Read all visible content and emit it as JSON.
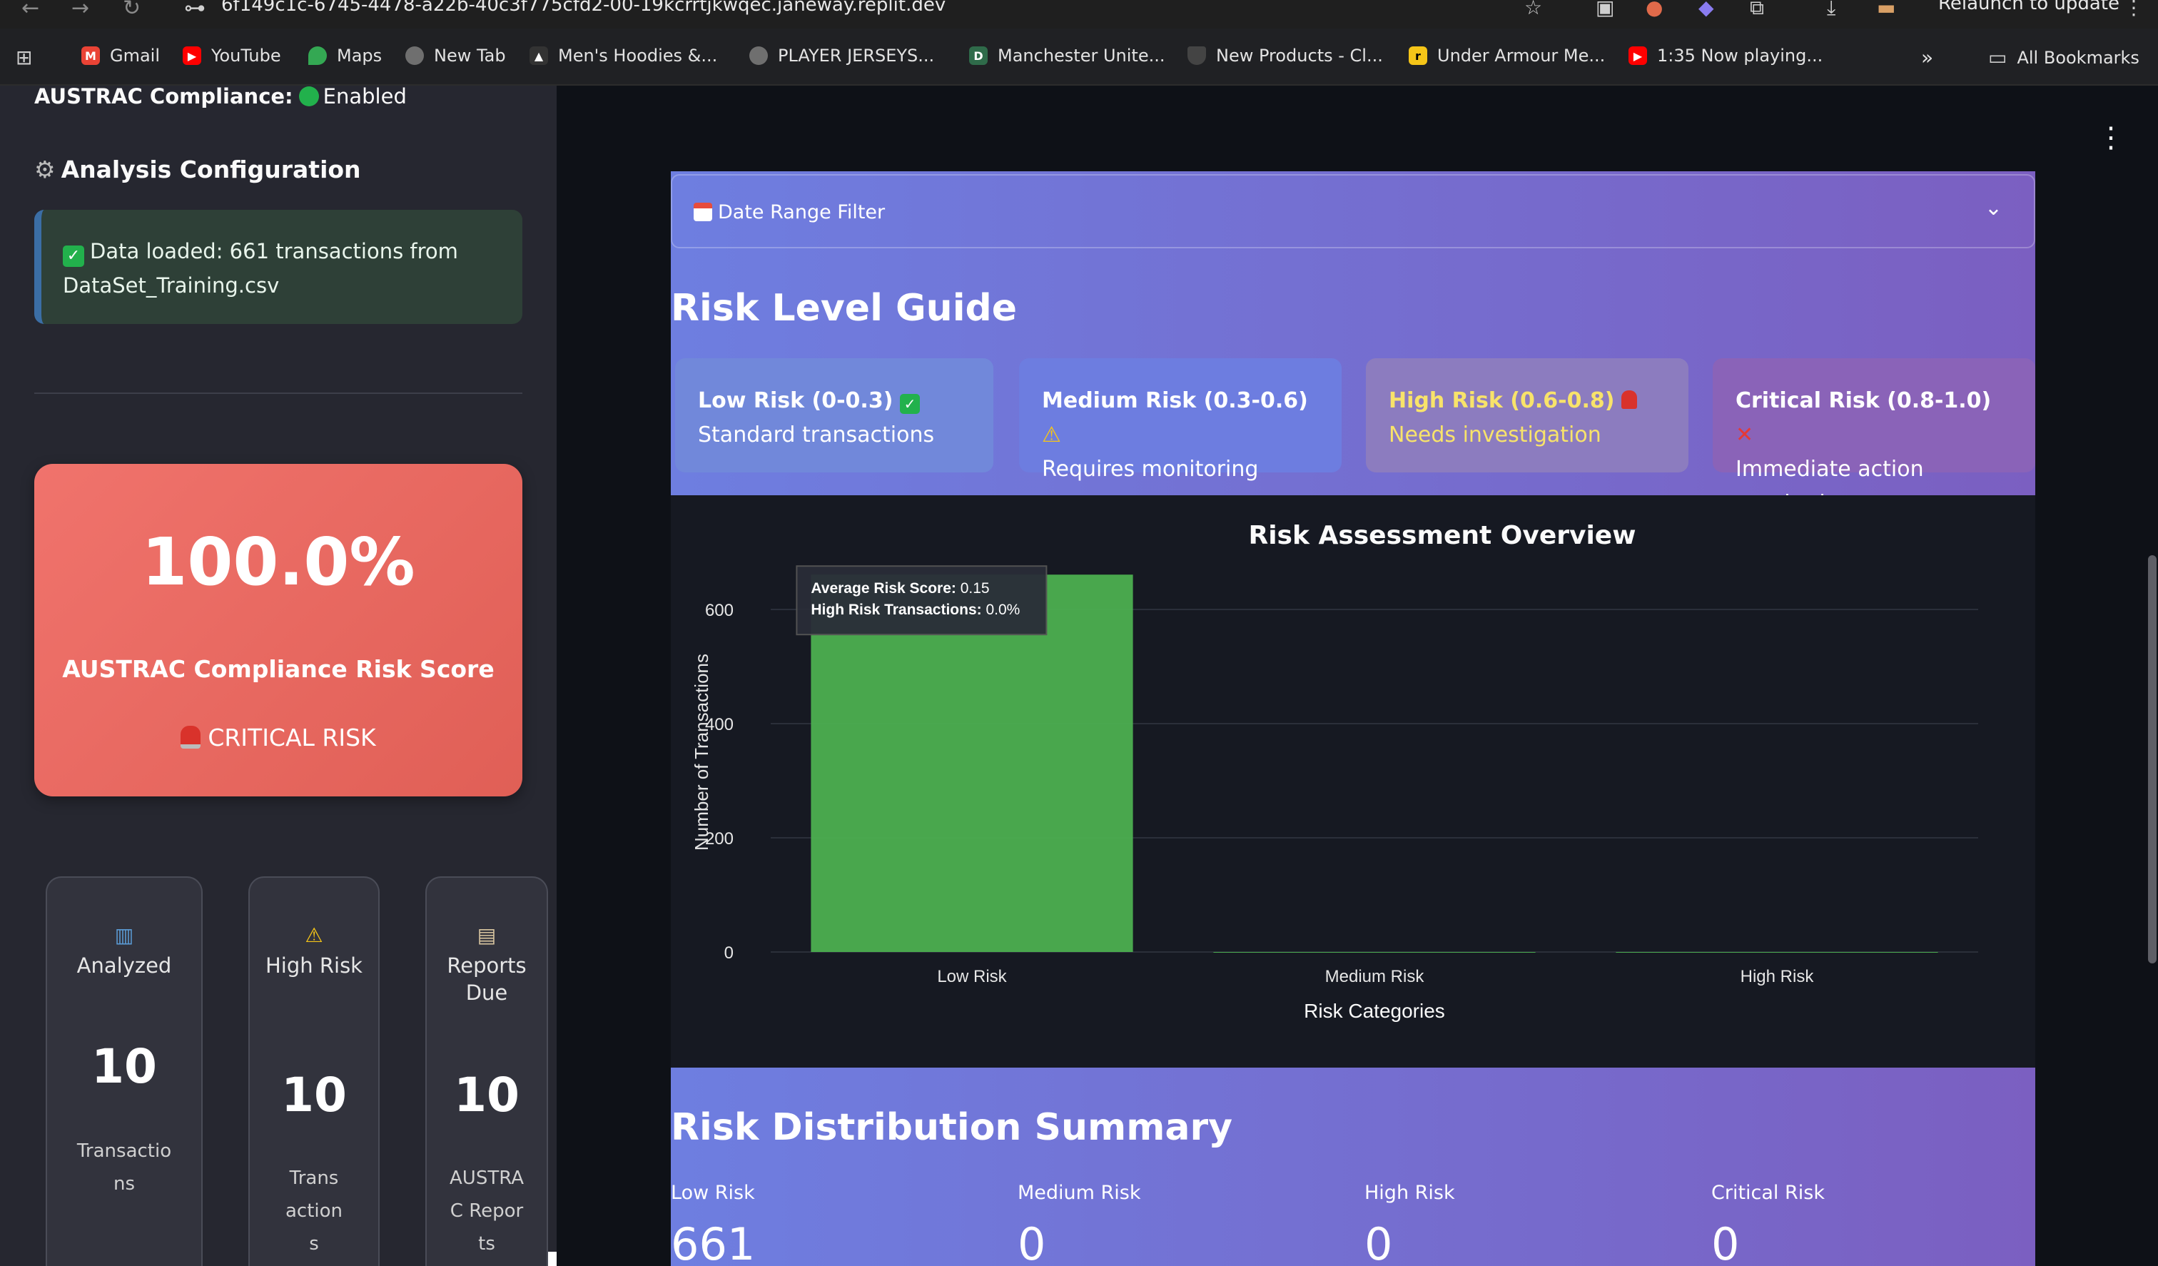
{
  "browser": {
    "url": "6f149c1c-6745-4478-a22b-40c3f775cfd2-00-19kcrrtjkwqec.janeway.replit.dev",
    "relaunch_label": "Relaunch to update",
    "bookmarks": [
      {
        "label": "Gmail",
        "icon": "gmail-icon",
        "color": "#ea4335"
      },
      {
        "label": "YouTube",
        "icon": "youtube-icon",
        "color": "#ff0000"
      },
      {
        "label": "Maps",
        "icon": "maps-pin-icon",
        "color": "#34a853"
      },
      {
        "label": "New Tab",
        "icon": "globe-icon",
        "color": "#8a8a8a"
      },
      {
        "label": "Men's Hoodies &...",
        "icon": "brand-icon",
        "color": "#444444"
      },
      {
        "label": "PLAYER JERSEYS...",
        "icon": "globe-icon",
        "color": "#8a8a8a"
      },
      {
        "label": "Manchester Unite...",
        "icon": "d-icon",
        "color": "#2f6b4a"
      },
      {
        "label": "New Products - Cl...",
        "icon": "shield-icon",
        "color": "#555555"
      },
      {
        "label": "Under Armour Me...",
        "icon": "r-icon",
        "color": "#f5c518"
      },
      {
        "label": "1:35 Now playing...",
        "icon": "youtube-icon",
        "color": "#ff0000"
      }
    ],
    "more_label": "»",
    "all_bookmarks": "All Bookmarks"
  },
  "sidebar": {
    "compliance_label": "AUSTRAC Compliance:",
    "compliance_value": "Enabled",
    "section_heading": "Analysis Configuration",
    "success_message": "Data loaded: 661 transactions from DataSet_Training.csv",
    "risk_score": {
      "value": "100.0%",
      "label": "AUSTRAC Compliance Risk Score",
      "status": "CRITICAL RISK"
    },
    "metrics": [
      {
        "icon": "bar-chart-icon",
        "label": "Analyzed",
        "value": "10",
        "sub": "Transactions"
      },
      {
        "icon": "warning-icon",
        "label": "High Risk",
        "value": "10",
        "sub": "Transactions"
      },
      {
        "icon": "clipboard-icon",
        "label": "Reports Due",
        "value": "10",
        "sub": "AUSTRAC Reports"
      }
    ]
  },
  "main": {
    "date_filter_label": "Date Range Filter",
    "guide_title": "Risk Level Guide",
    "levels": [
      {
        "name": "Low Risk (0-0.3)",
        "icon": "check-icon",
        "desc": "Standard transactions",
        "bg": "#7188da"
      },
      {
        "name": "Medium Risk (0.3-0.6)",
        "icon": "warning-icon",
        "desc": "Requires monitoring",
        "bg": "#6d7de0"
      },
      {
        "name": "High Risk (0.6-0.8)",
        "icon": "siren-icon",
        "desc": "Needs investigation",
        "bg": "#8c7cbf",
        "name_color": "#f8e36a",
        "desc_color": "#f8e36a"
      },
      {
        "name": "Critical Risk (0.8-1.0)",
        "icon": "cross-icon",
        "desc": "Immediate action required",
        "bg": "#8a63b8"
      }
    ],
    "distribution_title": "Risk Distribution Summary",
    "distribution": [
      {
        "label": "Low Risk",
        "value": "661"
      },
      {
        "label": "Medium Risk",
        "value": "0"
      },
      {
        "label": "High Risk",
        "value": "0"
      },
      {
        "label": "Critical Risk",
        "value": "0"
      }
    ]
  },
  "chart_data": {
    "type": "bar",
    "title": "Risk Assessment Overview",
    "xlabel": "Risk Categories",
    "ylabel": "Number of Transactions",
    "categories": [
      "Low Risk",
      "Medium Risk",
      "High Risk"
    ],
    "values": [
      661,
      0,
      0
    ],
    "ylim": [
      0,
      700
    ],
    "yticks": [
      0,
      200,
      400,
      600
    ],
    "bar_color": "#4caf50",
    "grid": true,
    "tooltip": {
      "line1_label": "Average Risk Score:",
      "line1_value": "0.15",
      "line2_label": "High Risk Transactions:",
      "line2_value": "0.0%"
    }
  }
}
